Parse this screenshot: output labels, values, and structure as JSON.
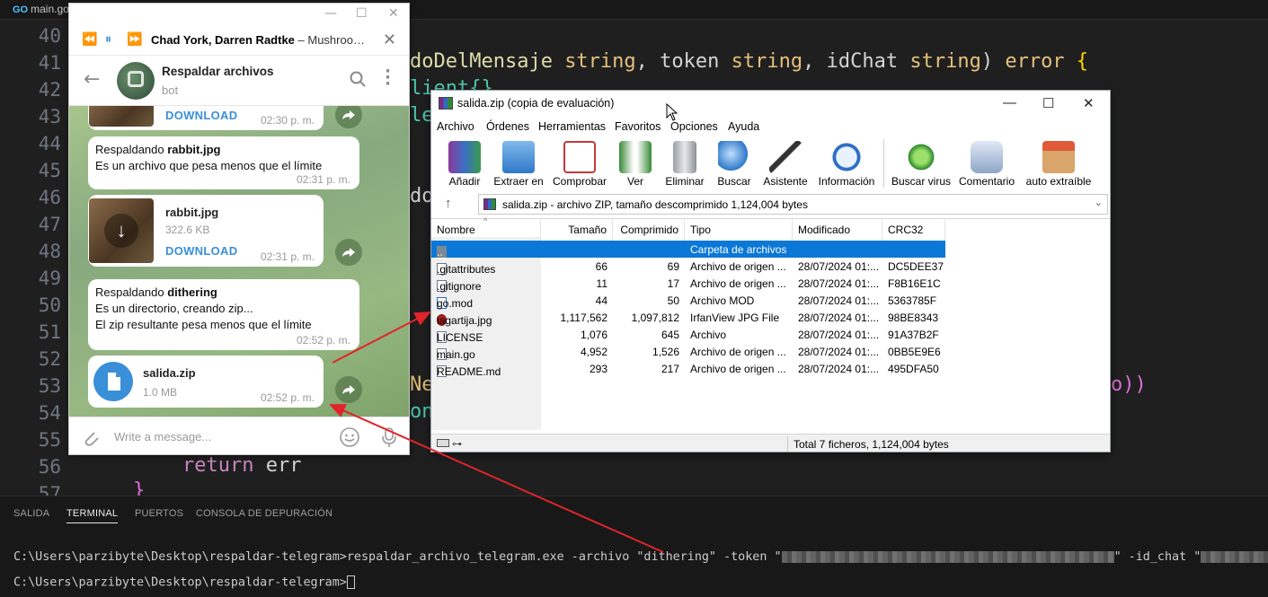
{
  "vscode": {
    "tab_label": "main.go",
    "go_mark": "GO",
    "line_numbers": [
      "40",
      "41",
      "42",
      "43",
      "44",
      "45",
      "46",
      "47",
      "48",
      "49",
      "50",
      "51",
      "52",
      "53",
      "54",
      "55",
      "56",
      "57"
    ],
    "code": {
      "l41_func": "doDelMensaje ",
      "l41_type1": "string",
      "l41_p2": ", token ",
      "l41_type2": "string",
      "l41_p3": ", idChat ",
      "l41_type3": "string",
      "l41_p4": ") ",
      "l41_ret": "error",
      "l41_brace": " {",
      "l42": "lient{}",
      "l43": "le",
      "l46": "do",
      "l53_ne": "Ne",
      "l53_end": "o))",
      "l54": "on",
      "l56_kw": "return",
      "l56_rest": " err",
      "l57": "}"
    }
  },
  "panel": {
    "tabs": [
      "SALIDA",
      "TERMINAL",
      "PUERTOS",
      "CONSOLA DE DEPURACIÓN"
    ],
    "active_tab": "TERMINAL",
    "line1_prefix": "C:\\Users\\parzibyte\\Desktop\\respaldar-telegram>respaldar_archivo_telegram.exe -archivo \"dithering\" -token \"",
    "line1_mid": "\" -id_chat \"",
    "line2": "C:\\Users\\parzibyte\\Desktop\\respaldar-telegram>"
  },
  "telegram": {
    "track": "Chad York, Darren Radtke",
    "track_title": " – Mushroo…",
    "chat_name": "Respaldar archivos",
    "chat_status": "bot",
    "messages": {
      "top_download": "DOWNLOAD",
      "top_time": "02:30 p. m.",
      "m1_prefix": "Respaldando ",
      "m1_bold": "rabbit.jpg",
      "m1_line2": "Es un archivo que pesa menos que el límite",
      "m1_time": "02:31 p. m.",
      "file1_name": "rabbit.jpg",
      "file1_size": "322.6 KB",
      "file1_download": "DOWNLOAD",
      "file1_time": "02:31 p. m.",
      "m2_prefix": "Respaldando ",
      "m2_bold": "dithering",
      "m2_line2": "Es un directorio, creando zip...",
      "m2_line3": "El zip resultante pesa menos que el límite",
      "m2_time": "02:52 p. m.",
      "file2_name": "salida.zip",
      "file2_size": "1.0 MB",
      "file2_time": "02:52 p. m."
    },
    "input_placeholder": "Write a message..."
  },
  "winrar": {
    "title": "salida.zip (copia de evaluación)",
    "menu": [
      "Archivo",
      "Órdenes",
      "Herramientas",
      "Favoritos",
      "Opciones",
      "Ayuda"
    ],
    "toolbar": [
      "Añadir",
      "Extraer en",
      "Comprobar",
      "Ver",
      "Eliminar",
      "Buscar",
      "Asistente",
      "Información",
      "Buscar virus",
      "Comentario",
      "auto extraíble"
    ],
    "address": "salida.zip - archivo ZIP, tamaño descomprimido 1,124,004 bytes",
    "columns": [
      "Nombre",
      "Tamaño",
      "Comprimido",
      "Tipo",
      "Modificado",
      "CRC32"
    ],
    "rows": [
      {
        "name": "..",
        "size": "",
        "packed": "",
        "type": "Carpeta de archivos",
        "modified": "",
        "crc": ""
      },
      {
        "name": ".gitattributes",
        "size": "66",
        "packed": "69",
        "type": "Archivo de origen ...",
        "modified": "28/07/2024 01:...",
        "crc": "DC5DEE37"
      },
      {
        "name": ".gitignore",
        "size": "11",
        "packed": "17",
        "type": "Archivo de origen ...",
        "modified": "28/07/2024 01:...",
        "crc": "F8B16E1C"
      },
      {
        "name": "go.mod",
        "size": "44",
        "packed": "50",
        "type": "Archivo MOD",
        "modified": "28/07/2024 01:...",
        "crc": "5363785F"
      },
      {
        "name": "lagartija.jpg",
        "size": "1,117,562",
        "packed": "1,097,812",
        "type": "IrfanView JPG File",
        "modified": "28/07/2024 01:...",
        "crc": "98BE8343"
      },
      {
        "name": "LICENSE",
        "size": "1,076",
        "packed": "645",
        "type": "Archivo",
        "modified": "28/07/2024 01:...",
        "crc": "91A37B2F"
      },
      {
        "name": "main.go",
        "size": "4,952",
        "packed": "1,526",
        "type": "Archivo de origen ...",
        "modified": "28/07/2024 01:...",
        "crc": "0BB5E9E6"
      },
      {
        "name": "README.md",
        "size": "293",
        "packed": "217",
        "type": "Archivo de origen ...",
        "modified": "28/07/2024 01:...",
        "crc": "495DFA50"
      }
    ],
    "status_total": "Total 7 ficheros, 1,124,004 bytes"
  },
  "colors": {
    "accent_blue": "#3a8fd9",
    "arrow_red": "#e0242a",
    "selection": "#0b78d7"
  }
}
